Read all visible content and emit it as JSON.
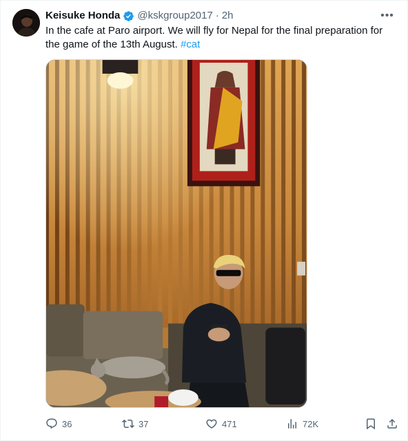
{
  "tweet": {
    "author_name": "Keisuke Honda",
    "handle": "@kskgroup2017",
    "separator": "·",
    "time": "2h",
    "more_label": "•••",
    "text": "In the cafe at Paro airport. We will fly for Nepal for the final preparation for the game of the 13th August. ",
    "hashtag": "#cat",
    "verified_color": "#1d9bf0",
    "link_color": "#1d9bf0"
  },
  "actions": {
    "reply_count": "36",
    "retweet_count": "37",
    "like_count": "471",
    "views_count": "72K",
    "icons": [
      "reply-icon",
      "retweet-icon",
      "like-icon",
      "views-icon",
      "bookmark-icon",
      "share-icon"
    ]
  }
}
